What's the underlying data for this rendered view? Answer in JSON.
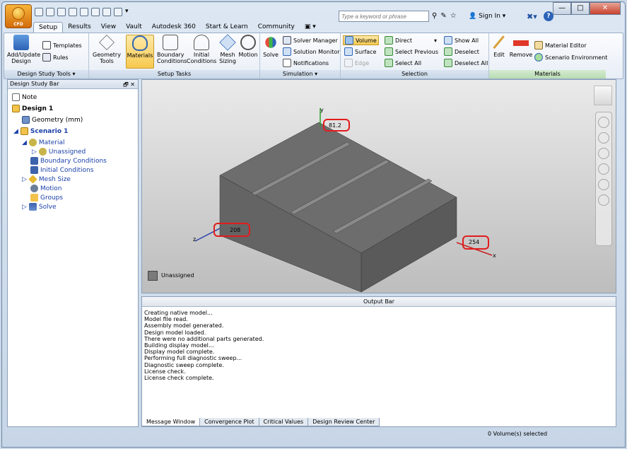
{
  "app": {
    "badge": "CFD"
  },
  "quick_access": {
    "overflow": "▾"
  },
  "search": {
    "placeholder": "Type a keyword or phrase"
  },
  "account": {
    "sign_in": "Sign In",
    "help_label": "?"
  },
  "window_buttons": {
    "minimize": "—",
    "maximize": "□",
    "close": "✕"
  },
  "tabs": [
    "Setup",
    "Results",
    "View",
    "Vault",
    "Autodesk 360",
    "Start & Learn",
    "Community",
    "▣ ▾"
  ],
  "ribbon": {
    "design_study_tools": {
      "title": "Design Study Tools ▾",
      "add_update": "Add/Update Design",
      "templates": "Templates",
      "rules": "Rules"
    },
    "setup_tasks": {
      "title": "Setup Tasks",
      "geometry_tools": "Geometry Tools",
      "materials": "Materials",
      "boundary_conditions": "Boundary Conditions",
      "initial_conditions": "Initial Conditions",
      "mesh_sizing": "Mesh Sizing",
      "motion": "Motion"
    },
    "simulation": {
      "title": "Simulation ▾",
      "solve": "Solve",
      "solver_manager": "Solver Manager",
      "solution_monitor": "Solution Monitor",
      "notifications": "Notifications"
    },
    "selection": {
      "title": "Selection",
      "volume": "Volume",
      "surface": "Surface",
      "edge": "Edge",
      "direct": "Direct",
      "select_previous": "Select Previous",
      "select_all": "Select All",
      "show_all": "Show All",
      "deselect": "Deselect",
      "deselect_all": "Deselect All"
    },
    "materials": {
      "title": "Materials",
      "edit": "Edit",
      "remove": "Remove",
      "material_editor": "Material Editor",
      "scenario_environment": "Scenario Environment"
    }
  },
  "design_study_bar": {
    "title": "Design Study Bar",
    "controls": "🗗 ✕",
    "tree": {
      "note": "Note",
      "design": "Design 1",
      "geometry": "Geometry (mm)",
      "scenario": "Scenario 1",
      "material": "Material",
      "unassigned": "Unassigned",
      "boundary_conditions": "Boundary Conditions",
      "initial_conditions": "Initial Conditions",
      "mesh_size": "Mesh Size",
      "motion": "Motion",
      "groups": "Groups",
      "solve": "Solve"
    }
  },
  "viewport": {
    "axis_y": "y",
    "axis_z": "z",
    "axis_x": "x",
    "dim_height": "81.2",
    "dim_depth": "208",
    "dim_width": "254",
    "legend_label": "Unassigned"
  },
  "output_bar": {
    "title": "Output Bar",
    "messages": [
      "Creating native model...",
      "Model file read.",
      "Assembly model generated.",
      "Design model loaded.",
      "There were no additional parts generated.",
      "Building display model...",
      "Display model complete.",
      "Performing full diagnostic sweep...",
      "Diagnostic sweep complete.",
      "License check.",
      "License check complete."
    ],
    "tabs": [
      "Message Window",
      "Convergence Plot",
      "Critical Values",
      "Design Review Center"
    ]
  },
  "status_bar": {
    "text": "0 Volume(s) selected"
  },
  "colors": {
    "accent_orange": "#e8901e",
    "highlight_red": "#e21c1c",
    "tree_blue": "#1a3fa9",
    "model_gray": "#6e6e6e"
  }
}
